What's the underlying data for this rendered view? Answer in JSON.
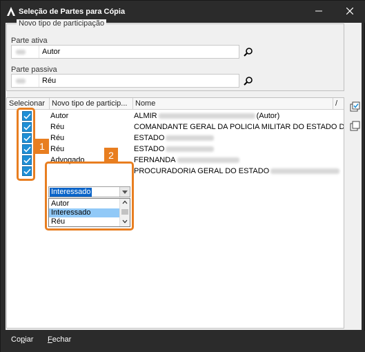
{
  "window": {
    "title": "Seleção de Partes para Cópia",
    "minimize_icon": "minimize-icon",
    "close_icon": "close-icon"
  },
  "group": {
    "legend": "Novo tipo de participação",
    "parte_ativa": {
      "label": "Parte ativa",
      "value": "Autor"
    },
    "parte_passiva": {
      "label": "Parte passiva",
      "value": "Réu"
    }
  },
  "grid": {
    "columns": [
      "Selecionar",
      "Novo tipo de particip...",
      "Nome",
      "/"
    ],
    "rows": [
      {
        "selected": true,
        "tipo": "Autor",
        "nome": "ALMIR",
        "nome_suffix": "(Autor)"
      },
      {
        "selected": true,
        "tipo": "Réu",
        "nome": "COMANDANTE GERAL DA POLICIA MILITAR DO ESTADO DO P",
        "nome_suffix": ""
      },
      {
        "selected": true,
        "tipo": "Réu",
        "nome": "ESTADO",
        "nome_suffix": ""
      },
      {
        "selected": true,
        "tipo": "Réu",
        "nome": "ESTADO",
        "nome_suffix": ""
      },
      {
        "selected": true,
        "tipo": "Advogado",
        "nome": "FERNANDA",
        "nome_suffix": ""
      },
      {
        "selected": true,
        "tipo": "Interessado",
        "nome": "PROCURADORIA GERAL DO ESTADO",
        "nome_suffix": ""
      }
    ]
  },
  "dropdown": {
    "selected": "Interessado",
    "options": [
      "Autor",
      "Interessado",
      "Réu"
    ],
    "highlighted": "Interessado"
  },
  "callouts": {
    "one": "1",
    "two": "2"
  },
  "footer": {
    "copy_prefix": "Co",
    "copy_underlined": "p",
    "copy_suffix": "iar",
    "close_underlined": "F",
    "close_suffix": "echar"
  },
  "colors": {
    "accent_orange": "#e87e20",
    "checkbox_blue": "#1e8fd6",
    "selection_blue": "#0a64c8",
    "highlight_blue": "#91c9f7",
    "titlebar": "#2b2b2b"
  }
}
